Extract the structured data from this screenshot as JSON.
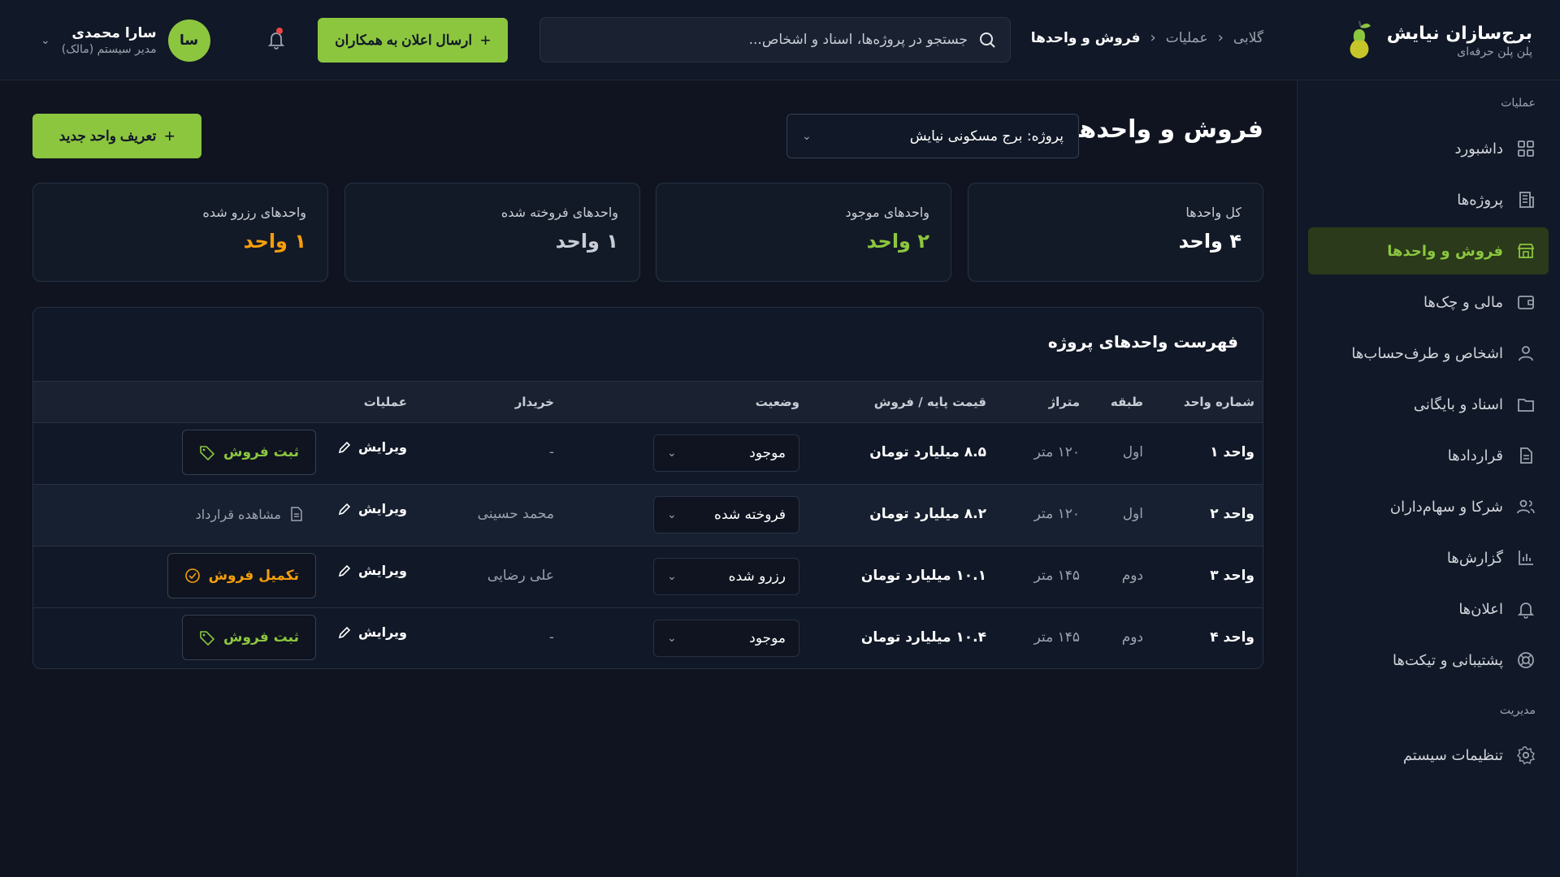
{
  "brand": {
    "name": "برج‌سازان نیایش",
    "subtitle": "پلن پلن حرفه‌ای"
  },
  "breadcrumb": [
    "گلابی",
    "عملیات",
    "فروش و واحدها"
  ],
  "search": {
    "placeholder": "جستجو در پروژه‌ها، اسناد و اشخاص..."
  },
  "header": {
    "announce_label": "ارسال اعلان به همکاران"
  },
  "user": {
    "initials": "سا",
    "name": "سارا محمدی",
    "role": "مدیر سیستم (مالک)"
  },
  "sidebar": {
    "section_ops": "عملیات",
    "section_admin": "مدیریت",
    "items": [
      {
        "label": "داشبورد",
        "icon": "dashboard-icon"
      },
      {
        "label": "پروژه‌ها",
        "icon": "building-icon"
      },
      {
        "label": "فروش و واحدها",
        "icon": "store-icon"
      },
      {
        "label": "مالی و چک‌ها",
        "icon": "wallet-icon"
      },
      {
        "label": "اشخاص و طرف‌حساب‌ها",
        "icon": "user-icon"
      },
      {
        "label": "اسناد و بایگانی",
        "icon": "folder-icon"
      },
      {
        "label": "قراردادها",
        "icon": "document-icon"
      },
      {
        "label": "شرکا و سهام‌داران",
        "icon": "users-icon"
      },
      {
        "label": "گزارش‌ها",
        "icon": "chart-icon"
      },
      {
        "label": "اعلان‌ها",
        "icon": "bell-icon"
      },
      {
        "label": "پشتیبانی و تیکت‌ها",
        "icon": "lifebuoy-icon"
      }
    ],
    "settings_label": "تنظیمات سیستم"
  },
  "main": {
    "title": "فروش و واحدها",
    "project_select": "پروژه: برج مسکونی نیایش",
    "new_unit_label": "تعریف واحد جدید"
  },
  "stats": [
    {
      "label": "کل واحدها",
      "value": "۴ واحد",
      "color": "#ffffff"
    },
    {
      "label": "واحدهای موجود",
      "value": "۲ واحد",
      "color": "#8cc63f"
    },
    {
      "label": "واحدهای فروخته شده",
      "value": "۱ واحد",
      "color": "#c8ccd4"
    },
    {
      "label": "واحدهای رزرو شده",
      "value": "۱ واحد",
      "color": "#f59e0b"
    }
  ],
  "table": {
    "title": "فهرست واحدهای پروژه",
    "headers": {
      "unit": "شماره واحد",
      "floor": "طبقه",
      "area": "متراژ",
      "price": "قیمت پایه / فروش",
      "status": "وضعیت",
      "buyer": "خریدار",
      "actions": "عملیات"
    },
    "edit_label": "ویرایش",
    "rows": [
      {
        "unit": "واحد ۱",
        "floor": "اول",
        "area": "۱۲۰ متر",
        "price": "۸.۵ میلیارد تومان",
        "status": "موجود",
        "buyer": "-",
        "action": "ثبت فروش"
      },
      {
        "unit": "واحد ۲",
        "floor": "اول",
        "area": "۱۲۰ متر",
        "price": "۸.۲ میلیارد تومان",
        "status": "فروخته شده",
        "buyer": "محمد حسینی",
        "action": "مشاهده قرارداد"
      },
      {
        "unit": "واحد ۳",
        "floor": "دوم",
        "area": "۱۴۵ متر",
        "price": "۱۰.۱ میلیارد تومان",
        "status": "رزرو شده",
        "buyer": "علی رضایی",
        "action": "تکمیل فروش"
      },
      {
        "unit": "واحد ۴",
        "floor": "دوم",
        "area": "۱۴۵ متر",
        "price": "۱۰.۴ میلیارد تومان",
        "status": "موجود",
        "buyer": "-",
        "action": "ثبت فروش"
      }
    ]
  }
}
